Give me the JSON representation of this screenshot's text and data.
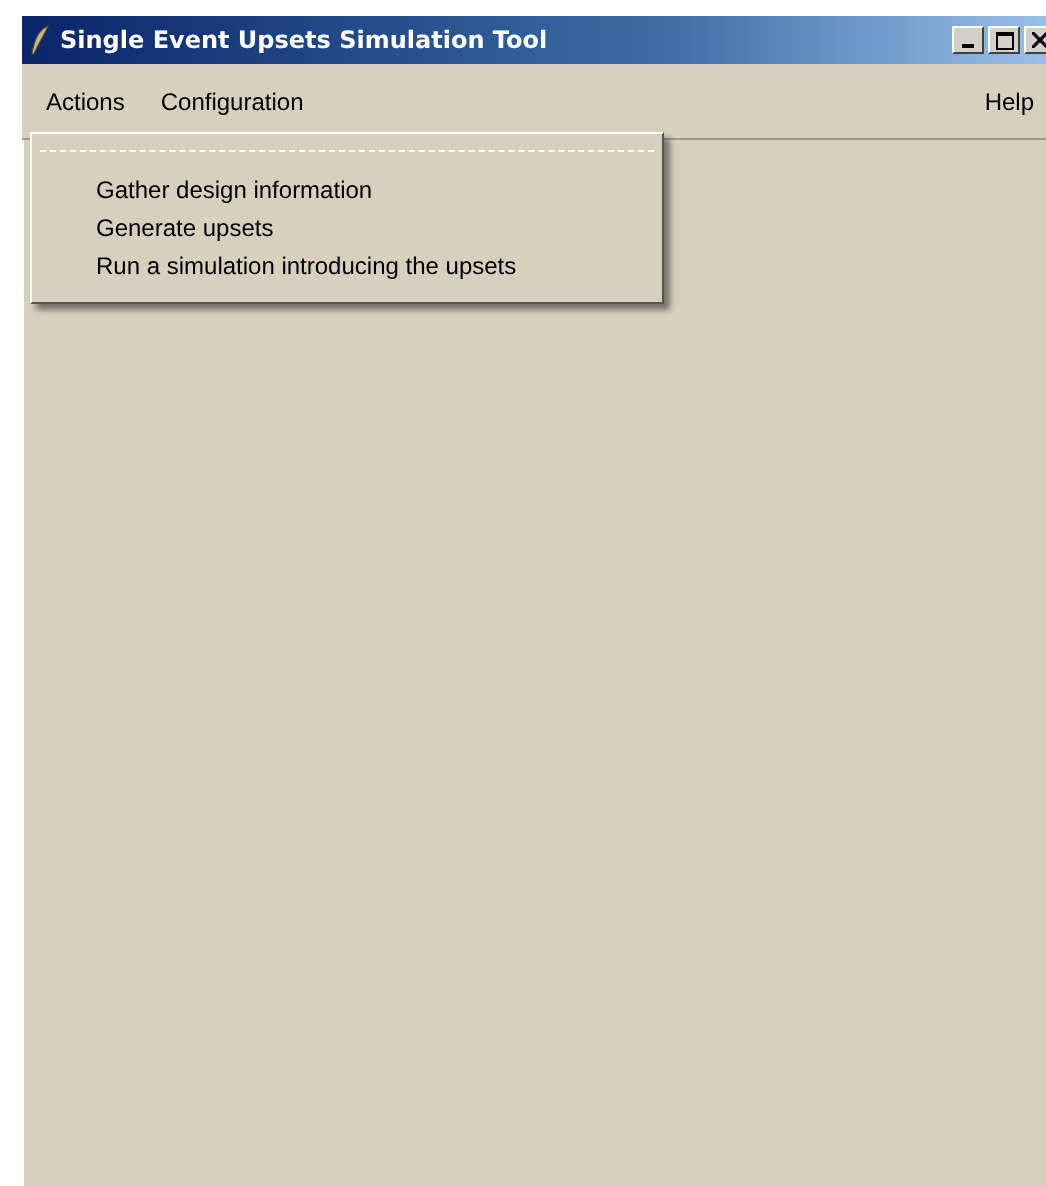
{
  "window": {
    "title": "Single Event Upsets Simulation Tool"
  },
  "menu_bar": {
    "left": [
      {
        "label": "Actions"
      },
      {
        "label": "Configuration"
      }
    ],
    "right": [
      {
        "label": "Help"
      }
    ]
  },
  "open_menu": {
    "items": [
      {
        "label": "Gather design information"
      },
      {
        "label": "Generate upsets"
      },
      {
        "label": "Run a simulation introducing the upsets"
      }
    ]
  }
}
